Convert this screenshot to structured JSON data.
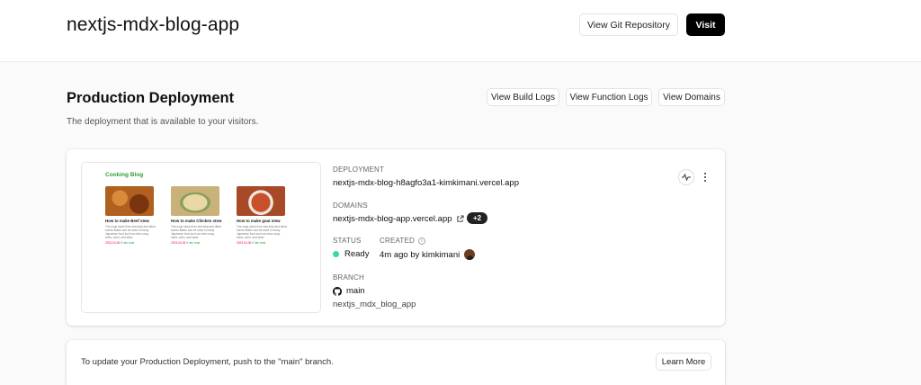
{
  "header": {
    "project_name": "nextjs-mdx-blog-app",
    "git_button": "View Git Repository",
    "visit_button": "Visit"
  },
  "production": {
    "title": "Production Deployment",
    "subtitle": "The deployment that is available to your visitors.",
    "build_logs_button": "View Build Logs",
    "function_logs_button": "View Function Logs",
    "domains_button": "View Domains"
  },
  "preview": {
    "site_title": "Cooking Blog",
    "items": [
      {
        "name": "How to make Beef stew",
        "desc": "The soup stock from sea kelp and dried bonito flakes can be used in many Japanese food such as miso soup, soba, udon, and stew.",
        "date": "2023-04-06",
        "read": "5 min read",
        "color": "#b0601f"
      },
      {
        "name": "How to make Chicken stew",
        "desc": "The soup stock from sea kelp and dried bonito flakes can be used in many Japanese food such as miso soup, soba, udon, and stew.",
        "date": "2023-04-06",
        "read": "5 min read",
        "color": "#c9b27a"
      },
      {
        "name": "How to make goat stew",
        "desc": "The soup stock from sea kelp and dried bonito flakes can be used in many Japanese food such as miso soup, soba, udon, and stew.",
        "date": "2023-04-06",
        "read": "5 min read",
        "color": "#a84a28"
      }
    ]
  },
  "deployment": {
    "deployment_label": "DEPLOYMENT",
    "deployment_url": "nextjs-mdx-blog-h8agfo3a1-kimkimani.vercel.app",
    "domains_label": "DOMAINS",
    "domain": "nextjs-mdx-blog-app.vercel.app",
    "extra_domains": "+2",
    "status_label": "STATUS",
    "status": "Ready",
    "status_color": "#3ed6a6",
    "created_label": "CREATED",
    "created": "4m ago by kimkimani",
    "branch_label": "BRANCH",
    "branch": "main",
    "commit": "nextjs_mdx_blog_app"
  },
  "update_notice": {
    "text": "To update your Production Deployment, push to the \"main\" branch.",
    "learn_more_button": "Learn More"
  }
}
